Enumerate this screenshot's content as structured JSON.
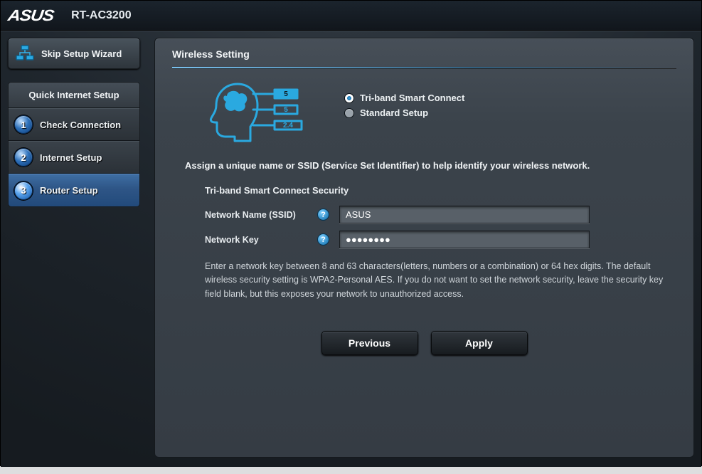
{
  "header": {
    "brand": "ASUS",
    "model": "RT-AC3200"
  },
  "sidebar": {
    "skip_label": "Skip Setup Wizard",
    "menu_title": "Quick Internet Setup",
    "steps": [
      {
        "num": "1",
        "label": "Check Connection"
      },
      {
        "num": "2",
        "label": "Internet Setup"
      },
      {
        "num": "3",
        "label": "Router Setup"
      }
    ]
  },
  "panel": {
    "title": "Wireless Setting",
    "mode_options": {
      "tri_band": "Tri-band Smart Connect",
      "standard": "Standard Setup",
      "selected": "tri_band"
    },
    "diagram_band_labels": [
      "5",
      "5",
      "2.4"
    ],
    "instruction": "Assign a unique name or SSID (Service Set Identifier) to help identify your wireless network.",
    "security_title": "Tri-band Smart Connect Security",
    "ssid_label": "Network Name (SSID)",
    "ssid_value": "ASUS",
    "key_label": "Network Key",
    "key_value": "●●●●●●●●",
    "help_glyph": "?",
    "footnote": "Enter a network key between 8 and 63 characters(letters, numbers or a combination) or 64 hex digits. The default wireless security setting is WPA2-Personal AES. If you do not want to set the network security, leave the security key field blank, but this exposes your network to unauthorized access.",
    "buttons": {
      "previous": "Previous",
      "apply": "Apply"
    }
  },
  "colors": {
    "accent": "#2fa3dd"
  }
}
